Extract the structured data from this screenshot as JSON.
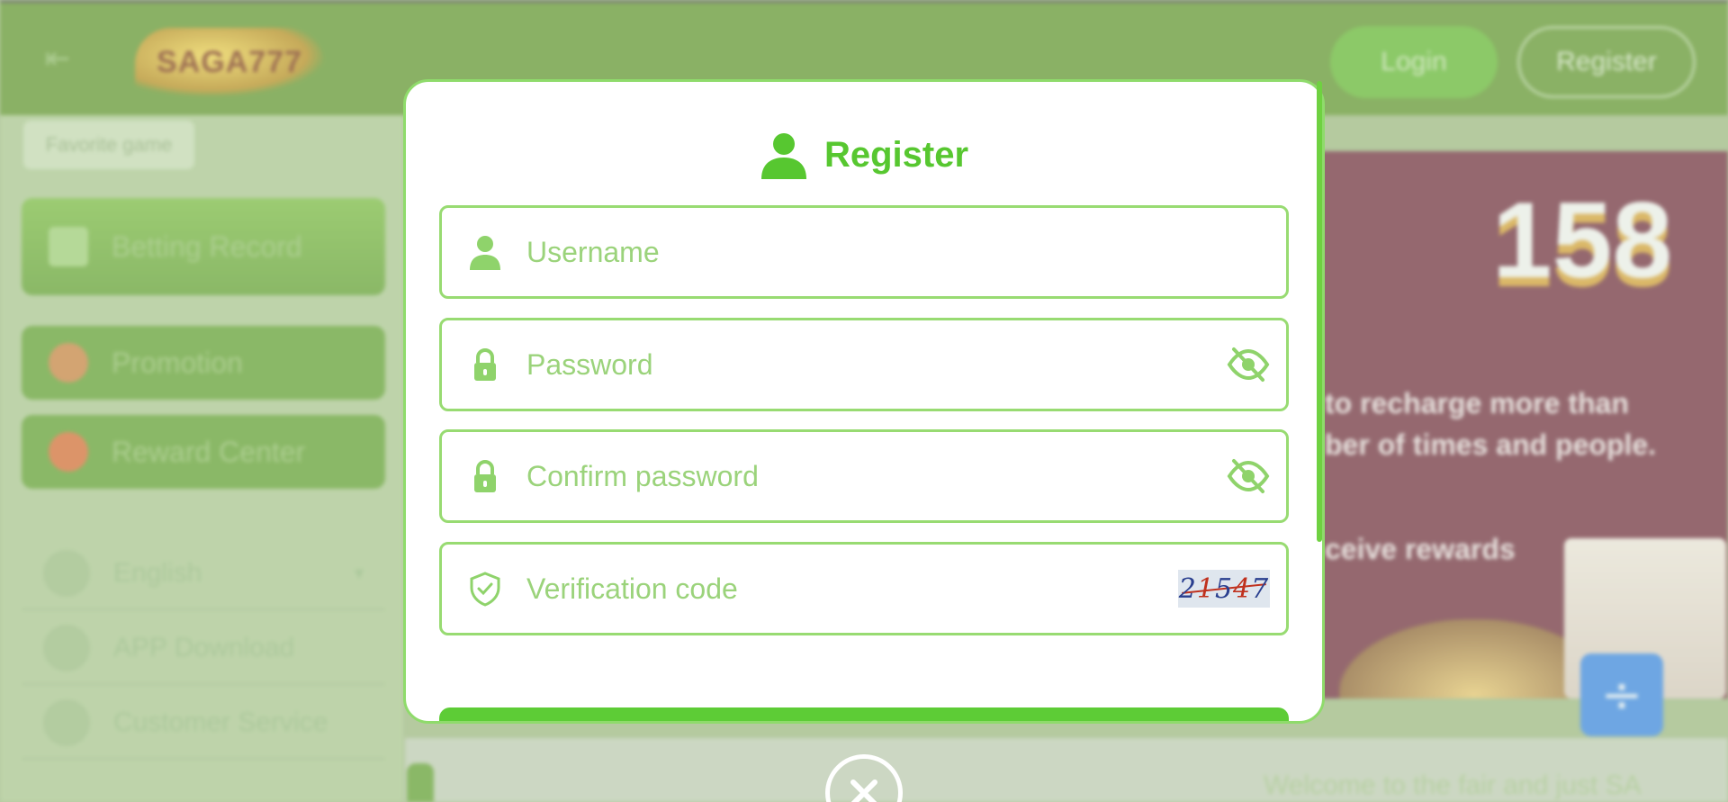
{
  "background": {
    "header": {
      "logo_text": "SAGA777",
      "login_label": "Login",
      "register_label": "Register"
    },
    "sidebar": {
      "favorite_chip": "Favorite game",
      "betting_record": "Betting Record",
      "promotion": "Promotion",
      "reward_center": "Reward Center",
      "language": "English",
      "app_download": "APP Download",
      "customer_service": "Customer Service"
    },
    "banner": {
      "number": "158",
      "line1": "to recharge more than",
      "line2": "ber of times and people.",
      "line3": "ceive rewards"
    },
    "welcome_text": "Welcome to the fair and just SA"
  },
  "modal": {
    "title": "Register",
    "fields": {
      "username": {
        "placeholder": "Username",
        "icon": "person-icon"
      },
      "password": {
        "placeholder": "Password",
        "icon": "lock-icon",
        "toggle_icon": "eye-off-icon"
      },
      "confirm_password": {
        "placeholder": "Confirm password",
        "icon": "lock-icon",
        "toggle_icon": "eye-off-icon"
      },
      "verification_code": {
        "placeholder": "Verification code",
        "icon": "shield-check-icon",
        "captcha_digits": [
          "2",
          "1",
          "5",
          "4",
          "7"
        ]
      }
    }
  },
  "colors": {
    "accent_green": "#57c730",
    "field_border": "#98db72",
    "placeholder": "#9bd37b",
    "header_green": "#5a8f25"
  }
}
